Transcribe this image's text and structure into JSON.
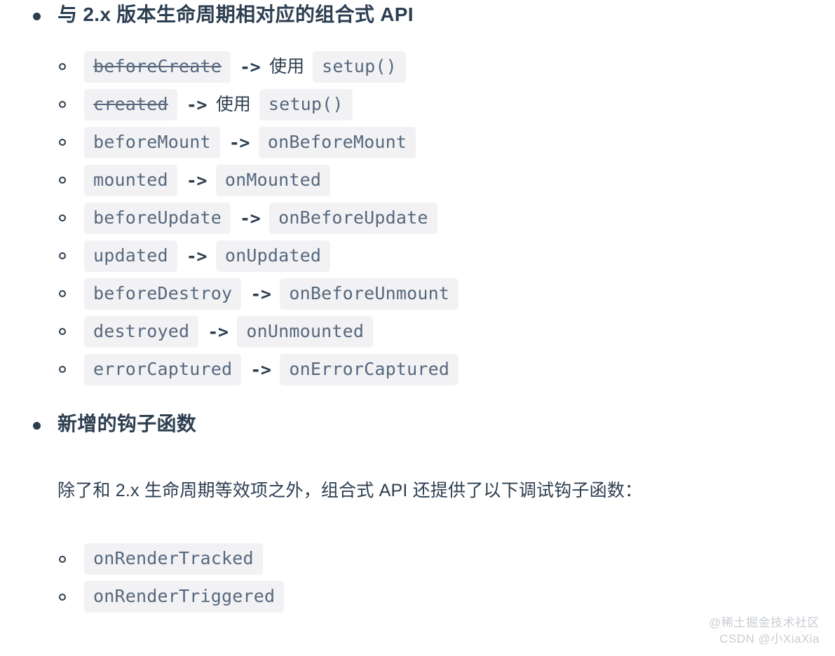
{
  "sections": [
    {
      "heading": "与 2.x 版本生命周期相对应的组合式 API",
      "items": [
        {
          "left": "beforeCreate",
          "left_struck": true,
          "arrow": "->",
          "mid": "使用",
          "right": "setup()"
        },
        {
          "left": "created",
          "left_struck": true,
          "arrow": "->",
          "mid": "使用",
          "right": "setup()"
        },
        {
          "left": "beforeMount",
          "left_struck": false,
          "arrow": "->",
          "mid": "",
          "right": "onBeforeMount"
        },
        {
          "left": "mounted",
          "left_struck": false,
          "arrow": "->",
          "mid": "",
          "right": "onMounted"
        },
        {
          "left": "beforeUpdate",
          "left_struck": false,
          "arrow": "->",
          "mid": "",
          "right": "onBeforeUpdate"
        },
        {
          "left": "updated",
          "left_struck": false,
          "arrow": "->",
          "mid": "",
          "right": "onUpdated"
        },
        {
          "left": "beforeDestroy",
          "left_struck": false,
          "arrow": "->",
          "mid": "",
          "right": "onBeforeUnmount"
        },
        {
          "left": "destroyed",
          "left_struck": false,
          "arrow": "->",
          "mid": "",
          "right": "onUnmounted"
        },
        {
          "left": "errorCaptured",
          "left_struck": false,
          "arrow": "->",
          "mid": "",
          "right": "onErrorCaptured"
        }
      ]
    },
    {
      "heading": "新增的钩子函数",
      "paragraph": "除了和 2.x 生命周期等效项之外，组合式 API 还提供了以下调试钩子函数：",
      "items": [
        {
          "left": "onRenderTracked",
          "left_struck": false,
          "arrow": "",
          "mid": "",
          "right": ""
        },
        {
          "left": "onRenderTriggered",
          "left_struck": false,
          "arrow": "",
          "mid": "",
          "right": ""
        }
      ]
    }
  ],
  "watermark": {
    "line1": "@稀土掘金技术社区",
    "line2": "CSDN @小XiaXia"
  },
  "colors": {
    "text": "#2c3e50",
    "code_text": "#56687e",
    "code_background": "#f2f2f4",
    "page_background": "#ffffff",
    "watermark": "#c9cdd2"
  }
}
